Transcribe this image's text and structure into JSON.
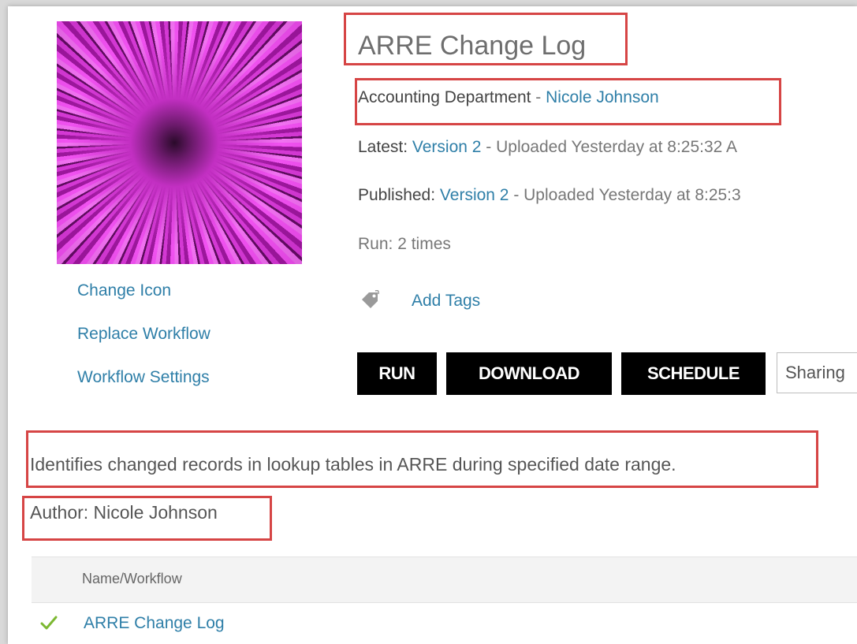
{
  "workflow": {
    "title": "ARRE Change Log",
    "department_label": "Accounting Department",
    "department_separator": " - ",
    "owner_name": "Nicole Johnson",
    "latest_label": "Latest:",
    "latest_version": "Version 2",
    "latest_text": " - Uploaded Yesterday at 8:25:32 A",
    "published_label": "Published:",
    "published_version": "Version 2",
    "published_text": " - Uploaded Yesterday at 8:25:3",
    "run_count": "Run: 2 times",
    "add_tags": "Add Tags",
    "description": "Identifies changed records in lookup tables in ARRE during specified date range.",
    "author": "Author: Nicole Johnson"
  },
  "sidebar": {
    "links": [
      "Change Icon",
      "Replace Workflow",
      "Workflow Settings"
    ]
  },
  "actions": {
    "run": "RUN",
    "download": "DOWNLOAD",
    "schedule": "SCHEDULE",
    "sharing": "Sharing"
  },
  "table": {
    "column_header": "Name/Workflow",
    "rows": [
      {
        "name": "ARRE Change Log",
        "status_icon": "checkmark-icon"
      }
    ]
  },
  "colors": {
    "link": "#2f7fa8",
    "highlight_box": "#d64545",
    "button_bg": "#000000",
    "check": "#7cb832"
  }
}
